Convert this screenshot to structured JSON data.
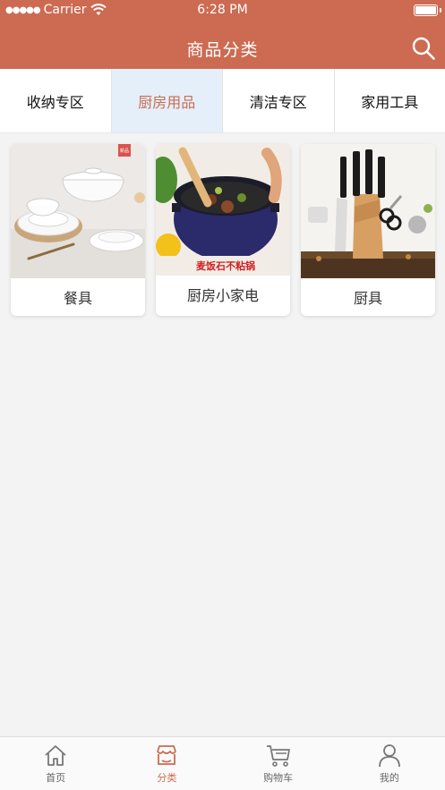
{
  "status_bar": {
    "carrier": "Carrier",
    "time": "6:28 PM"
  },
  "header": {
    "title": "商品分类"
  },
  "tabs": [
    {
      "label": "收纳专区",
      "active": false
    },
    {
      "label": "厨房用品",
      "active": true
    },
    {
      "label": "清洁专区",
      "active": false
    },
    {
      "label": "家用工具",
      "active": false
    }
  ],
  "products": [
    {
      "label": "餐具",
      "image": "tableware-photo"
    },
    {
      "label": "厨房小家电",
      "image": "pot-photo",
      "caption": "麦饭石不粘锅"
    },
    {
      "label": "厨具",
      "image": "knife-set-photo"
    }
  ],
  "tabbar": [
    {
      "label": "首页",
      "icon": "home-icon",
      "active": false
    },
    {
      "label": "分类",
      "icon": "category-icon",
      "active": true
    },
    {
      "label": "购物车",
      "icon": "cart-icon",
      "active": false
    },
    {
      "label": "我的",
      "icon": "user-icon",
      "active": false
    }
  ],
  "colors": {
    "brand": "#cc6b52",
    "active_tab_bg": "#e4effa",
    "page_bg": "#f3f3f3"
  }
}
